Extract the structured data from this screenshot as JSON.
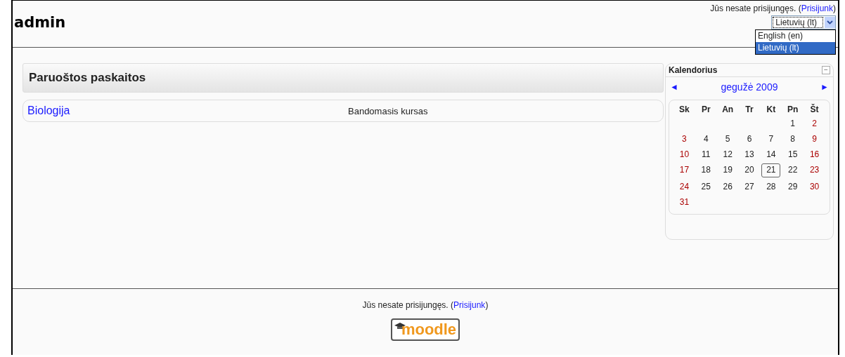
{
  "header": {
    "title": "admin",
    "login_info": {
      "text": "Jūs nesate prisijungęs. (",
      "link": "Prisijunk",
      "after": ")"
    },
    "language_select": {
      "value": "Lietuvių (lt)",
      "expanded": true,
      "options": [
        {
          "label": "English (en)",
          "selected": false
        },
        {
          "label": "Lietuvių (lt)",
          "selected": true
        }
      ]
    }
  },
  "courses_block": {
    "title": "Paruoštos paskaitos",
    "courses": [
      {
        "name": "Biologija",
        "summary": "Bandomasis kursas"
      }
    ]
  },
  "calendar": {
    "title": "Kalendorius",
    "collapse_icon": "−",
    "prev": "◄",
    "month": "gegužė 2009",
    "next": "►",
    "weekdays": [
      "Sk",
      "Pr",
      "An",
      "Tr",
      "Kt",
      "Pn",
      "Št"
    ],
    "weeks": [
      {
        "kind": "end",
        "days": [
          {
            "day": "1",
            "weekend": false,
            "today": false
          },
          {
            "day": "2",
            "weekend": true,
            "today": false
          }
        ]
      },
      {
        "kind": "full",
        "days": [
          {
            "day": "3",
            "weekend": true,
            "today": false
          },
          {
            "day": "4",
            "weekend": false,
            "today": false
          },
          {
            "day": "5",
            "weekend": false,
            "today": false
          },
          {
            "day": "6",
            "weekend": false,
            "today": false
          },
          {
            "day": "7",
            "weekend": false,
            "today": false
          },
          {
            "day": "8",
            "weekend": false,
            "today": false
          },
          {
            "day": "9",
            "weekend": true,
            "today": false
          }
        ]
      },
      {
        "kind": "full",
        "days": [
          {
            "day": "10",
            "weekend": true,
            "today": false
          },
          {
            "day": "11",
            "weekend": false,
            "today": false
          },
          {
            "day": "12",
            "weekend": false,
            "today": false
          },
          {
            "day": "13",
            "weekend": false,
            "today": false
          },
          {
            "day": "14",
            "weekend": false,
            "today": false
          },
          {
            "day": "15",
            "weekend": false,
            "today": false
          },
          {
            "day": "16",
            "weekend": true,
            "today": false
          }
        ]
      },
      {
        "kind": "full",
        "days": [
          {
            "day": "17",
            "weekend": true,
            "today": false
          },
          {
            "day": "18",
            "weekend": false,
            "today": false
          },
          {
            "day": "19",
            "weekend": false,
            "today": false
          },
          {
            "day": "20",
            "weekend": false,
            "today": false
          },
          {
            "day": "21",
            "weekend": false,
            "today": true
          },
          {
            "day": "22",
            "weekend": false,
            "today": false
          },
          {
            "day": "23",
            "weekend": true,
            "today": false
          }
        ]
      },
      {
        "kind": "full",
        "days": [
          {
            "day": "24",
            "weekend": true,
            "today": false
          },
          {
            "day": "25",
            "weekend": false,
            "today": false
          },
          {
            "day": "26",
            "weekend": false,
            "today": false
          },
          {
            "day": "27",
            "weekend": false,
            "today": false
          },
          {
            "day": "28",
            "weekend": false,
            "today": false
          },
          {
            "day": "29",
            "weekend": false,
            "today": false
          },
          {
            "day": "30",
            "weekend": true,
            "today": false
          }
        ]
      },
      {
        "kind": "start",
        "days": [
          {
            "day": "31",
            "weekend": true,
            "today": false
          }
        ]
      }
    ]
  },
  "footer": {
    "login_info": {
      "text": "Jūs nesate prisijungęs. (",
      "link": "Prisijunk",
      "after": ")"
    },
    "logo": "moodle"
  }
}
